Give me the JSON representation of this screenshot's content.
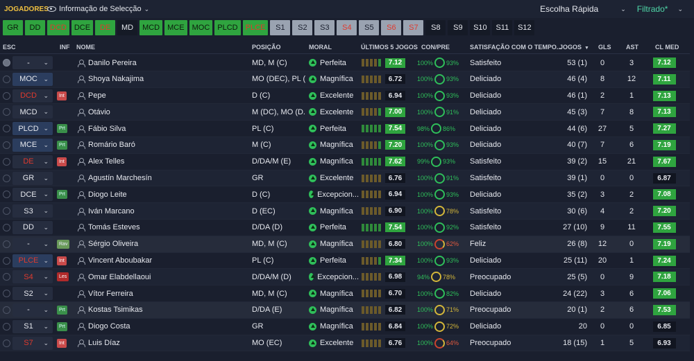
{
  "topbar": {
    "title": "JOGADORES",
    "view": "Informação de Selecção",
    "quick": "Escolha Rápida",
    "filtered": "Filtrado*"
  },
  "positions": [
    {
      "label": "GR",
      "style": "green"
    },
    {
      "label": "DD",
      "style": "green"
    },
    {
      "label": "DCD",
      "style": "green",
      "red": true
    },
    {
      "label": "DCE",
      "style": "green"
    },
    {
      "label": "DE",
      "style": "green",
      "red": true
    },
    {
      "label": "MD",
      "style": "dark"
    },
    {
      "label": "MCD",
      "style": "green"
    },
    {
      "label": "MCE",
      "style": "green"
    },
    {
      "label": "MOC",
      "style": "green"
    },
    {
      "label": "PLCD",
      "style": "green"
    },
    {
      "label": "PLCE",
      "style": "green",
      "red": true
    },
    {
      "label": "S1",
      "style": "gray"
    },
    {
      "label": "S2",
      "style": "gray"
    },
    {
      "label": "S3",
      "style": "gray"
    },
    {
      "label": "S4",
      "style": "gray",
      "red": true
    },
    {
      "label": "S5",
      "style": "gray"
    },
    {
      "label": "S6",
      "style": "gray",
      "red": true
    },
    {
      "label": "S7",
      "style": "gray",
      "red": true
    },
    {
      "label": "S8",
      "style": "dark"
    },
    {
      "label": "S9",
      "style": "dark"
    },
    {
      "label": "S10",
      "style": "dark"
    },
    {
      "label": "S11",
      "style": "dark"
    },
    {
      "label": "S12",
      "style": "dark"
    }
  ],
  "headers": {
    "esc": "ESC",
    "inf": "INF",
    "nome": "NOME",
    "posicao": "POSIÇÃO",
    "moral": "MORAL",
    "ultimos": "ÚLTIMOS 5 JOGOS",
    "conpre": "CON/PRE",
    "satis": "SATISFAÇÃO COM O TEMPO...",
    "jogos": "JOGOS",
    "gls": "GLS",
    "ast": "AST",
    "clmed": "CL MED"
  },
  "rows": [
    {
      "sel": "-",
      "selRed": false,
      "inf": "",
      "name": "Danilo Pereira",
      "pos": "MD, M (C)",
      "moral": "Perfeita",
      "bars": "yyyyg",
      "last": "7.12",
      "lastG": true,
      "con": "100%",
      "conY": false,
      "pre": "93%",
      "preC": "g",
      "satis": "Satisfeito",
      "jogos": "53 (1)",
      "gls": "0",
      "ast": "3",
      "cl": "7.12",
      "clG": true,
      "checked": true
    },
    {
      "sel": "MOC",
      "selRed": false,
      "selBlue": true,
      "inf": "",
      "name": "Shoya Nakajima",
      "pos": "MO (DEC), PL (...",
      "moral": "Magnífica",
      "bars": "yyyyy",
      "last": "6.72",
      "lastG": false,
      "con": "100%",
      "conY": false,
      "pre": "93%",
      "preC": "g",
      "satis": "Deliciado",
      "jogos": "46 (4)",
      "gls": "8",
      "ast": "12",
      "cl": "7.11",
      "clG": true
    },
    {
      "sel": "DCD",
      "selRed": true,
      "inf": "Int",
      "name": "Pepe",
      "pos": "D (C)",
      "moral": "Excelente",
      "bars": "yyyyy",
      "last": "6.94",
      "lastG": false,
      "con": "100%",
      "conY": false,
      "pre": "93%",
      "preC": "g",
      "satis": "Deliciado",
      "jogos": "46 (1)",
      "gls": "2",
      "ast": "1",
      "cl": "7.13",
      "clG": true
    },
    {
      "sel": "MCD",
      "selRed": false,
      "inf": "",
      "name": "Otávio",
      "pos": "M (DC), MO (D...",
      "moral": "Excelente",
      "bars": "yyyyg",
      "last": "7.00",
      "lastG": true,
      "con": "100%",
      "conY": false,
      "pre": "91%",
      "preC": "g",
      "satis": "Deliciado",
      "jogos": "45 (3)",
      "gls": "7",
      "ast": "8",
      "cl": "7.13",
      "clG": true
    },
    {
      "sel": "PLCD",
      "selRed": false,
      "selBlue": true,
      "inf": "Prt",
      "name": "Fábio Silva",
      "pos": "PL (C)",
      "moral": "Perfeita",
      "bars": "ggggg",
      "last": "7.54",
      "lastG": true,
      "con": "98%",
      "conY": false,
      "pre": "86%",
      "preC": "g",
      "satis": "Deliciado",
      "jogos": "44 (6)",
      "gls": "27",
      "ast": "5",
      "cl": "7.27",
      "clG": true
    },
    {
      "sel": "MCE",
      "selRed": false,
      "selBlue": true,
      "inf": "Prt",
      "name": "Romário Baró",
      "pos": "M (C)",
      "moral": "Magnífica",
      "bars": "yyyyg",
      "last": "7.20",
      "lastG": true,
      "con": "100%",
      "conY": false,
      "pre": "93%",
      "preC": "g",
      "satis": "Deliciado",
      "jogos": "40 (7)",
      "gls": "7",
      "ast": "6",
      "cl": "7.19",
      "clG": true
    },
    {
      "sel": "DE",
      "selRed": true,
      "inf": "Int",
      "name": "Alex Telles",
      "pos": "D/DA/M (E)",
      "moral": "Magnífica",
      "bars": "ggggg",
      "last": "7.62",
      "lastG": true,
      "con": "99%",
      "conY": false,
      "pre": "93%",
      "preC": "g",
      "satis": "Satisfeito",
      "jogos": "39 (2)",
      "gls": "15",
      "ast": "21",
      "cl": "7.67",
      "clG": true
    },
    {
      "sel": "GR",
      "selRed": false,
      "inf": "",
      "name": "Agustín Marchesín",
      "pos": "GR",
      "moral": "Excelente",
      "bars": "yyyyy",
      "last": "6.76",
      "lastG": false,
      "con": "100%",
      "conY": false,
      "pre": "91%",
      "preC": "g",
      "satis": "Satisfeito",
      "jogos": "39 (1)",
      "gls": "0",
      "ast": "0",
      "cl": "6.87",
      "clG": false
    },
    {
      "sel": "DCE",
      "selRed": false,
      "inf": "Prt",
      "name": "Diogo Leite",
      "pos": "D (C)",
      "moral": "Excepcion...",
      "bars": "yyyyy",
      "last": "6.94",
      "lastG": false,
      "con": "100%",
      "conY": false,
      "pre": "93%",
      "preC": "g",
      "satis": "Deliciado",
      "jogos": "35 (2)",
      "gls": "3",
      "ast": "2",
      "cl": "7.08",
      "clG": true
    },
    {
      "sel": "S3",
      "selRed": false,
      "inf": "",
      "name": "Iván Marcano",
      "pos": "D (EC)",
      "moral": "Magnífica",
      "bars": "yyyyy",
      "last": "6.90",
      "lastG": false,
      "con": "100%",
      "conY": false,
      "pre": "78%",
      "preC": "y",
      "satis": "Satisfeito",
      "jogos": "30 (6)",
      "gls": "4",
      "ast": "2",
      "cl": "7.20",
      "clG": true
    },
    {
      "sel": "DD",
      "selRed": false,
      "inf": "",
      "name": "Tomás Esteves",
      "pos": "D/DA (D)",
      "moral": "Perfeita",
      "bars": "ggggg",
      "last": "7.54",
      "lastG": true,
      "con": "100%",
      "conY": false,
      "pre": "92%",
      "preC": "g",
      "satis": "Satisfeito",
      "jogos": "27 (10)",
      "gls": "9",
      "ast": "11",
      "cl": "7.55",
      "clG": true
    },
    {
      "sel": "-",
      "selRed": false,
      "inf": "Rav",
      "name": "Sérgio Oliveira",
      "pos": "MD, M (C)",
      "moral": "Magnífica",
      "bars": "yyyyy",
      "last": "6.80",
      "lastG": false,
      "con": "100%",
      "conY": false,
      "pre": "62%",
      "preC": "r",
      "satis": "Feliz",
      "jogos": "26 (8)",
      "gls": "12",
      "ast": "0",
      "cl": "7.19",
      "clG": true,
      "hl": true
    },
    {
      "sel": "PLCE",
      "selRed": true,
      "selBlue": true,
      "inf": "Int",
      "name": "Vincent Aboubakar",
      "pos": "PL (C)",
      "moral": "Perfeita",
      "bars": "yyyyg",
      "last": "7.34",
      "lastG": true,
      "con": "100%",
      "conY": false,
      "pre": "93%",
      "preC": "g",
      "satis": "Deliciado",
      "jogos": "25 (11)",
      "gls": "20",
      "ast": "1",
      "cl": "7.24",
      "clG": true
    },
    {
      "sel": "S4",
      "selRed": true,
      "inf": "Les",
      "name": "Omar Elabdellaoui",
      "pos": "D/DA/M (D)",
      "moral": "Excepcion...",
      "bars": "yyyyy",
      "last": "6.98",
      "lastG": false,
      "con": "94%",
      "conY": false,
      "pre": "78%",
      "preC": "y",
      "satis": "Preocupado",
      "jogos": "25 (5)",
      "gls": "0",
      "ast": "9",
      "cl": "7.18",
      "clG": true
    },
    {
      "sel": "S2",
      "selRed": false,
      "inf": "",
      "name": "Vítor Ferreira",
      "pos": "MD, M (C)",
      "moral": "Magnífica",
      "bars": "yyyyy",
      "last": "6.70",
      "lastG": false,
      "con": "100%",
      "conY": false,
      "pre": "82%",
      "preC": "g",
      "satis": "Deliciado",
      "jogos": "24 (22)",
      "gls": "3",
      "ast": "6",
      "cl": "7.06",
      "clG": true
    },
    {
      "sel": "-",
      "selRed": false,
      "inf": "Prt",
      "name": "Kostas Tsimikas",
      "pos": "D/DA (E)",
      "moral": "Magnífica",
      "bars": "yyyyy",
      "last": "6.82",
      "lastG": false,
      "con": "100%",
      "conY": false,
      "pre": "71%",
      "preC": "y",
      "satis": "Preocupado",
      "jogos": "20 (1)",
      "gls": "2",
      "ast": "6",
      "cl": "7.53",
      "clG": true,
      "hl": true
    },
    {
      "sel": "S1",
      "selRed": false,
      "inf": "Prt",
      "name": "Diogo Costa",
      "pos": "GR",
      "moral": "Magnífica",
      "bars": "yyyyy",
      "last": "6.84",
      "lastG": false,
      "con": "100%",
      "conY": false,
      "pre": "72%",
      "preC": "y",
      "satis": "Deliciado",
      "jogos": "20",
      "gls": "0",
      "ast": "0",
      "cl": "6.85",
      "clG": false
    },
    {
      "sel": "S7",
      "selRed": true,
      "inf": "Int",
      "name": "Luis Díaz",
      "pos": "MO (EC)",
      "moral": "Excelente",
      "bars": "yyyyy",
      "last": "6.76",
      "lastG": false,
      "con": "100%",
      "conY": false,
      "pre": "64%",
      "preC": "r",
      "satis": "Preocupado",
      "jogos": "18 (15)",
      "gls": "1",
      "ast": "5",
      "cl": "6.93",
      "clG": false
    }
  ]
}
